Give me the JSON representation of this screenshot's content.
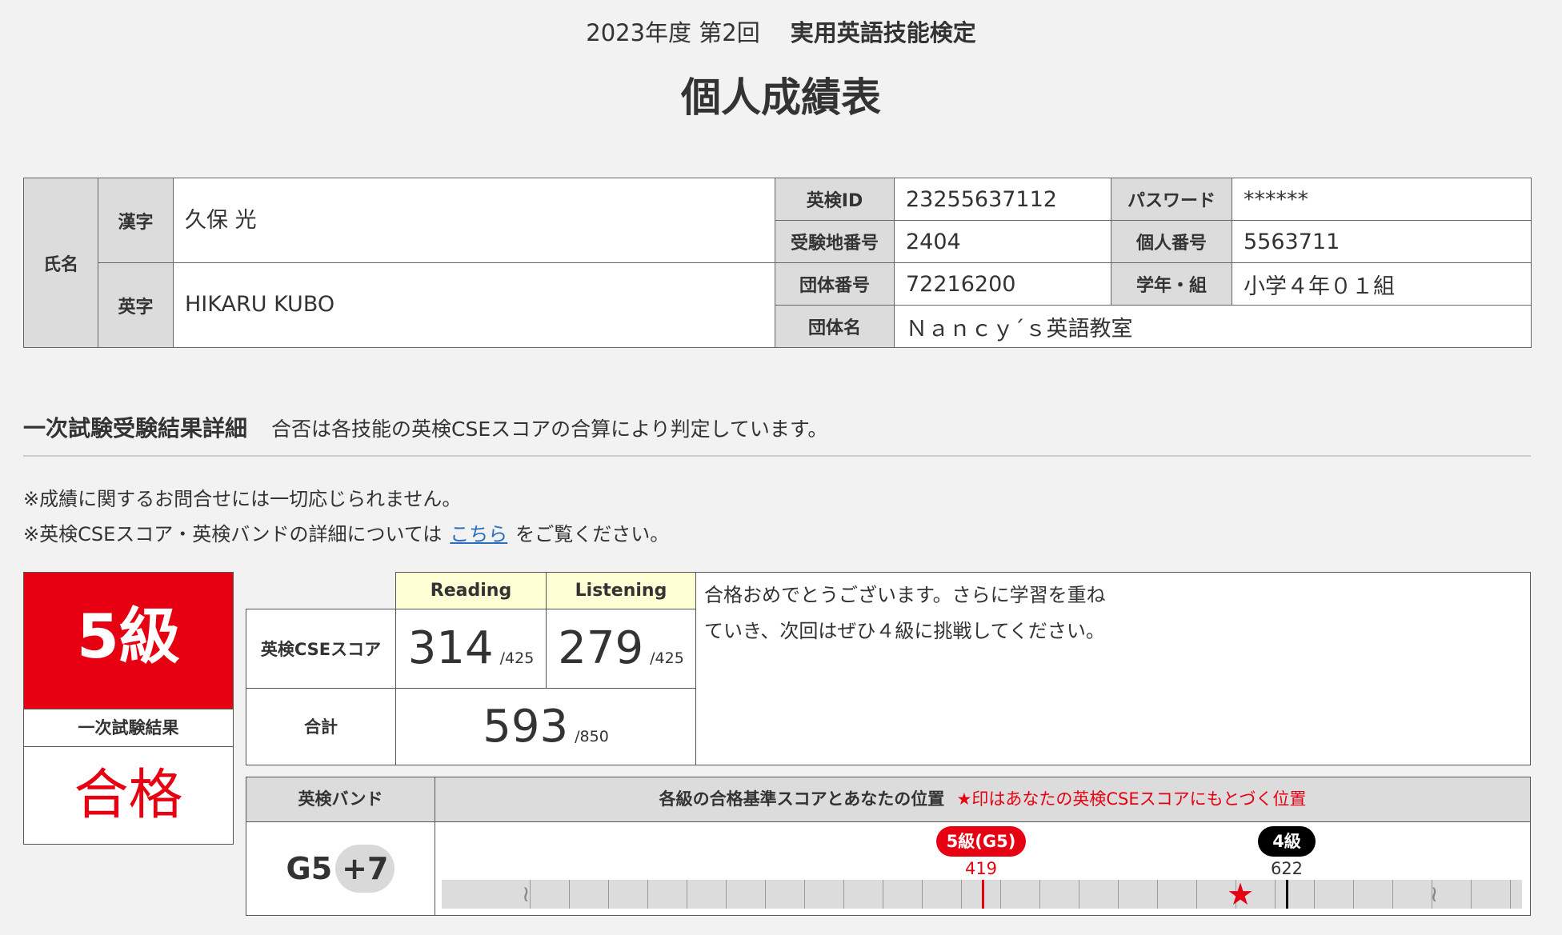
{
  "header": {
    "session": "2023年度 第2回",
    "exam_name": "実用英語技能検定",
    "title": "個人成績表"
  },
  "info": {
    "name_label": "氏名",
    "kanji_label": "漢字",
    "kanji_value": "久保 光",
    "roman_label": "英字",
    "roman_value": "HIKARU KUBO",
    "eiken_id_label": "英検ID",
    "eiken_id_value": "23255637112",
    "password_label": "パスワード",
    "password_value": "******",
    "site_no_label": "受験地番号",
    "site_no_value": "2404",
    "personal_no_label": "個人番号",
    "personal_no_value": "5563711",
    "group_no_label": "団体番号",
    "group_no_value": "72216200",
    "grade_class_label": "学年・組",
    "grade_class_value": "小学４年０１組",
    "group_name_label": "団体名",
    "group_name_value": "Ｎａｎｃｙ´ｓ英語教室"
  },
  "section": {
    "heading": "一次試験受験結果詳細",
    "subtext": "合否は各技能の英検CSEスコアの合算により判定しています。",
    "note1": "※成績に関するお問合せには一切応じられません。",
    "note2_pre": "※英検CSEスコア・英検バンドの詳細については",
    "note2_link": "こちら",
    "note2_post": "をご覧ください。"
  },
  "result": {
    "grade": "5級",
    "result_label": "一次試験結果",
    "result_value": "合格"
  },
  "scores": {
    "reading_label": "Reading",
    "listening_label": "Listening",
    "cse_label": "英検CSEスコア",
    "reading": "314",
    "reading_max": "/425",
    "listening": "279",
    "listening_max": "/425",
    "total_label": "合計",
    "total": "593",
    "total_max": "/850"
  },
  "message": "合格おめでとうございます。さらに学習を重ねていき、次回はぜひ４級に挑戦してください。",
  "band": {
    "band_label": "英検バンド",
    "band_base": "G5",
    "band_plus": "+7",
    "chart_title": "各級の合格基準スコアとあなたの位置",
    "chart_note": "★印はあなたの英検CSEスコアにもとづく位置",
    "marker1_label": "5級(G5)",
    "marker1_score": "419",
    "marker1_color": "#e60012",
    "marker2_label": "4級",
    "marker2_score": "622",
    "marker2_color": "#000000",
    "your_score": 593,
    "star_icon": "star-icon"
  }
}
